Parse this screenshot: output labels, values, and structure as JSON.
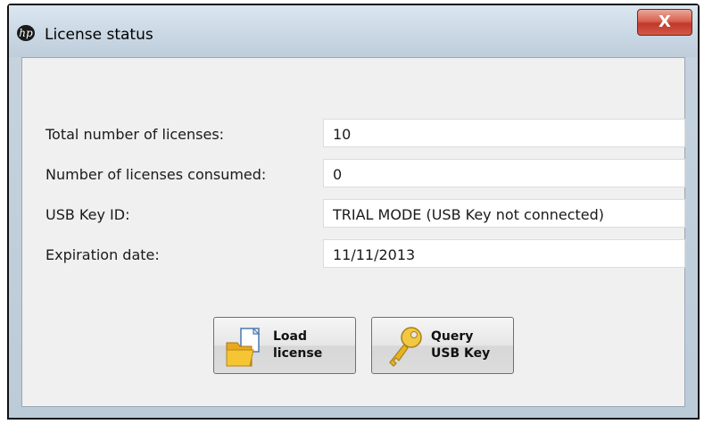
{
  "window": {
    "title": "License status",
    "logo_text": "hp",
    "close_label": "X"
  },
  "fields": [
    {
      "label": "Total number of licenses:",
      "value": "10"
    },
    {
      "label": "Number of licenses consumed:",
      "value": "0"
    },
    {
      "label": "USB Key ID:",
      "value": "TRIAL MODE (USB Key not connected)"
    },
    {
      "label": "Expiration date:",
      "value": "11/11/2013"
    }
  ],
  "buttons": {
    "load": {
      "line1": "Load",
      "line2": "license",
      "icon": "folder-document-icon"
    },
    "query": {
      "line1": "Query",
      "line2": "USB Key",
      "icon": "key-icon"
    }
  },
  "colors": {
    "close": "#c0392b",
    "folder": "#f5c533",
    "key": "#e6b422"
  }
}
